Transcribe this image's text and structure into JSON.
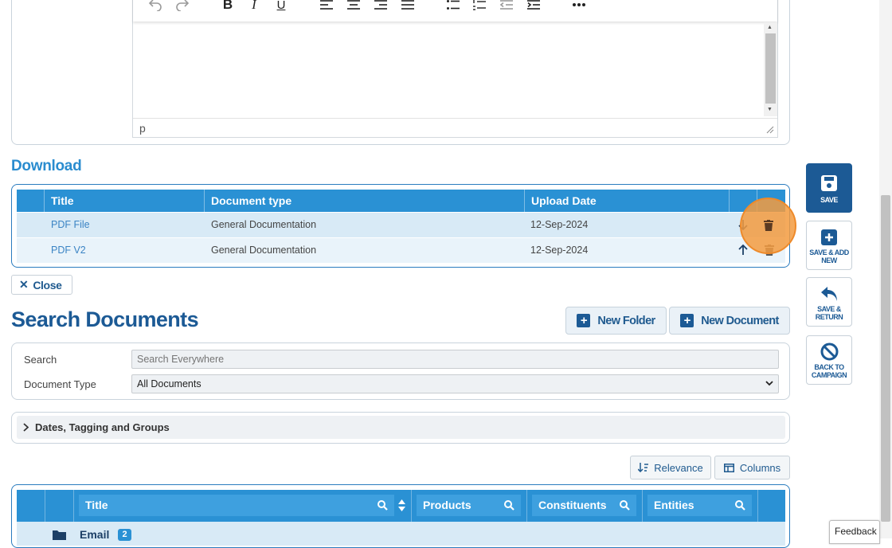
{
  "editor": {
    "status_path": "p",
    "toolbar": [
      "undo-icon",
      "redo-icon",
      "bold-icon",
      "italic-icon",
      "underline-icon",
      "align-left-icon",
      "align-center-icon",
      "align-right-icon",
      "align-justify-icon",
      "bullet-list-icon",
      "numbered-list-icon",
      "outdent-icon",
      "indent-icon",
      "more-icon"
    ]
  },
  "download": {
    "title": "Download",
    "columns": [
      "Title",
      "Document type",
      "Upload Date"
    ],
    "rows": [
      {
        "title": "PDF File",
        "type": "General Documentation",
        "date": "12-Sep-2024"
      },
      {
        "title": "PDF V2",
        "type": "General Documentation",
        "date": "12-Sep-2024"
      }
    ]
  },
  "close_label": "Close",
  "search_docs": {
    "heading": "Search Documents",
    "new_folder_label": "New Folder",
    "new_document_label": "New Document",
    "search_label": "Search",
    "search_placeholder": "Search Everywhere",
    "doc_type_label": "Document Type",
    "doc_type_value": "All Documents",
    "accordion_label": "Dates, Tagging and Groups",
    "relevance_label": "Relevance",
    "columns_label": "Columns",
    "grid_columns": [
      "Title",
      "Products",
      "Constituents",
      "Entities"
    ],
    "first_row": {
      "title": "Email",
      "badge": "2"
    }
  },
  "side_actions": {
    "save": "SAVE",
    "save_add_new": "SAVE & ADD NEW",
    "save_return": "SAVE & RETURN",
    "back_campaign": "BACK TO CAMPAIGN"
  },
  "feedback_label": "Feedback",
  "colors": {
    "primary": "#1c5a95",
    "accent": "#2a91d4",
    "highlight": "#f39b40"
  }
}
